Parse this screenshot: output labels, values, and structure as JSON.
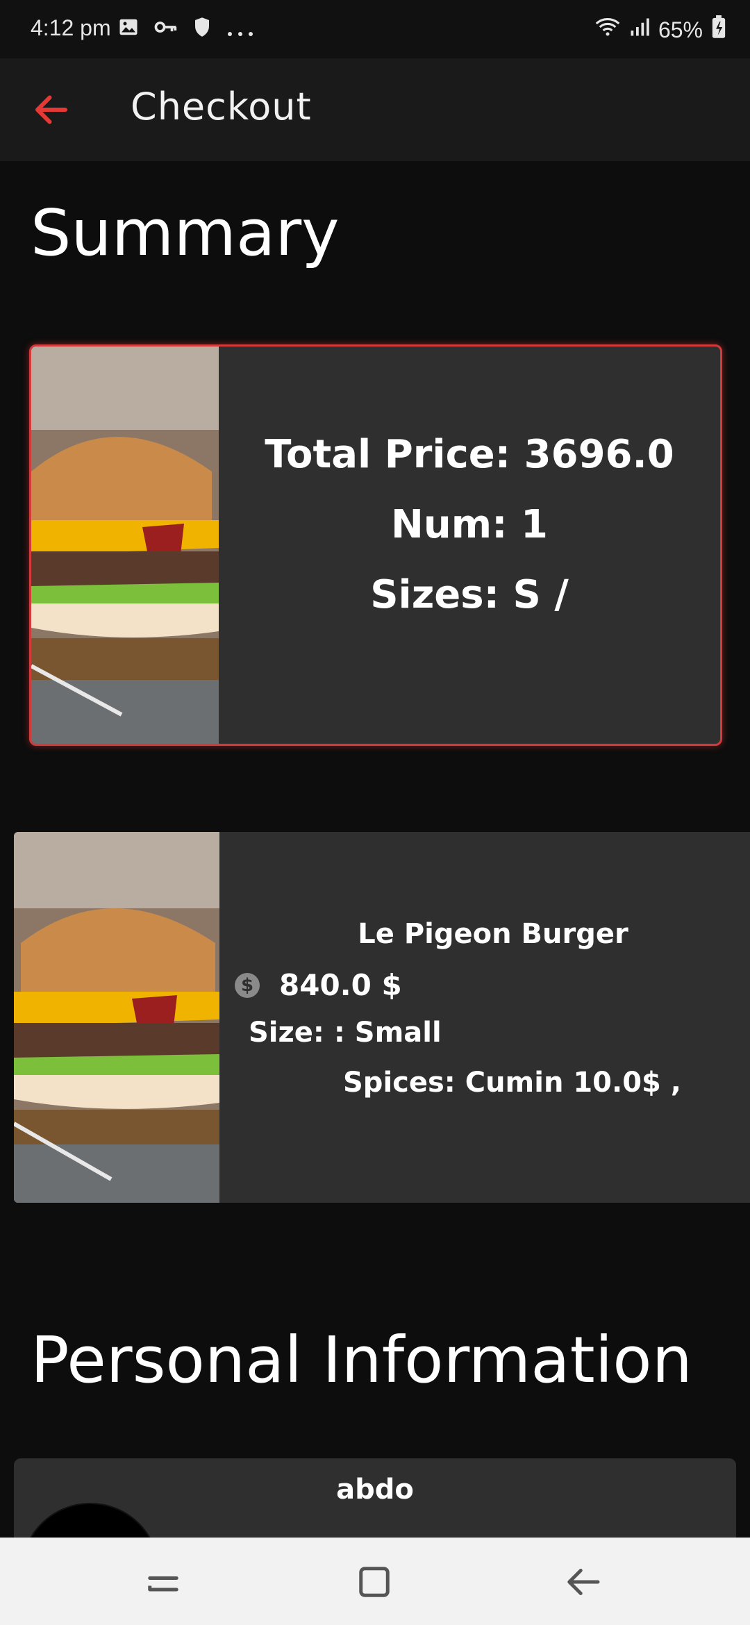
{
  "status_bar": {
    "time": "4:12 pm",
    "battery": "65%",
    "icons_left": [
      "image-icon",
      "key-icon",
      "shield-icon",
      "more-dots-icon"
    ],
    "icons_right": [
      "wifi-icon",
      "signal-icon",
      "battery-icon"
    ]
  },
  "app_bar": {
    "title": "Checkout",
    "back_icon": "arrow-back-icon",
    "accent_color": "#e53935"
  },
  "summary": {
    "heading": "Summary",
    "total_price": "Total Price: 3696.0",
    "num": "Num: 1",
    "sizes": "Sizes: S /",
    "image_icon": "burger-image",
    "border_color": "#d23b3b"
  },
  "items": [
    {
      "name": "Le Pigeon Burger",
      "price": "840.0 $",
      "size": "Size: : Small",
      "spices": "Spices: Cumin 10.0$ ,",
      "price_icon": "dollar-coin-icon"
    }
  ],
  "personal": {
    "heading": "Personal Information",
    "name": "abdo"
  },
  "nav_bar": {
    "buttons": [
      "recent-apps-icon",
      "home-icon",
      "back-icon"
    ]
  }
}
